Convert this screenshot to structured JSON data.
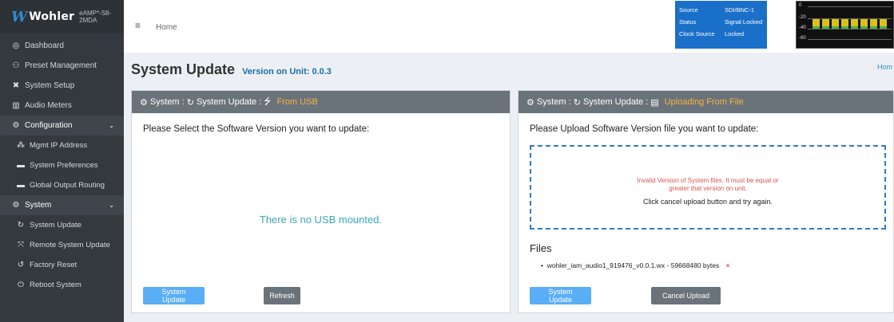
{
  "brand": {
    "logo_mark": "W",
    "logo_text": "Wohler",
    "model": "eAMP*-S8-2MDA"
  },
  "sidebar": {
    "items": [
      {
        "label": "Dashboard",
        "icon": "dashboard-icon",
        "glyph": "◎"
      },
      {
        "label": "Preset Management",
        "icon": "users-icon",
        "glyph": "⚇"
      },
      {
        "label": "System Setup",
        "icon": "tools-icon",
        "glyph": "✖"
      },
      {
        "label": "Audio Meters",
        "icon": "chart-icon",
        "glyph": "▥"
      },
      {
        "label": "Configuration",
        "icon": "gear-icon",
        "glyph": "⚙"
      },
      {
        "label": "Mgmt IP Address",
        "icon": "network-icon",
        "glyph": "⁂"
      },
      {
        "label": "System Preferences",
        "icon": "keyboard-icon",
        "glyph": "▬"
      },
      {
        "label": "Global Output Routing",
        "icon": "keyboard-icon",
        "glyph": "▬"
      },
      {
        "label": "System",
        "icon": "gears-icon",
        "glyph": "⚙"
      },
      {
        "label": "System Update",
        "icon": "refresh-icon",
        "glyph": "↻"
      },
      {
        "label": "Remote System Update",
        "icon": "remote-icon",
        "glyph": "⤧"
      },
      {
        "label": "Factory Reset",
        "icon": "undo-icon",
        "glyph": "↺"
      },
      {
        "label": "Reboot System",
        "icon": "power-icon",
        "glyph": "⏻"
      }
    ],
    "chevron": "⌄"
  },
  "topbar": {
    "menu_glyph": "≡",
    "home": "Home",
    "status": [
      {
        "k": "Source",
        "v": "SDI/BNC-1"
      },
      {
        "k": "Status",
        "v": "Signal Locked"
      },
      {
        "k": "Clock Source",
        "v": "Locked"
      }
    ],
    "meter_scale": [
      "0",
      "-20",
      "-40",
      "-60"
    ]
  },
  "page": {
    "title": "System Update",
    "version_label": "Version on Unit: 0.0.3",
    "breadcrumb_right": "Hom"
  },
  "left_panel": {
    "head_system": "System :",
    "head_update": "System Update :",
    "head_source": "From USB",
    "prompt": "Please Select the Software Version you want to update:",
    "no_usb": "There is no USB mounted.",
    "btn_update": "System Update",
    "btn_refresh": "Refresh"
  },
  "right_panel": {
    "head_system": "System :",
    "head_update": "System Update :",
    "head_source": "Uploading From File",
    "prompt": "Please Upload Software Version file you want to update:",
    "error_line1": "Invalid Version of System files. It must be equal or",
    "error_line2": "greater that version on unit.",
    "hint": "Click cancel upload button and try again.",
    "files_title": "Files",
    "file_name": "wohler_iam_audio1_919476_v0.0.1.wx - 59668480 bytes",
    "remove_glyph": "×",
    "btn_update": "System Update",
    "btn_cancel": "Cancel Upload"
  },
  "colors": {
    "sidebar": "#33393d",
    "panel_head": "#6b737a",
    "accent": "#f5b342",
    "primary": "#5aaef5",
    "status_blue": "#1a6fc9",
    "error": "#d9534f"
  }
}
